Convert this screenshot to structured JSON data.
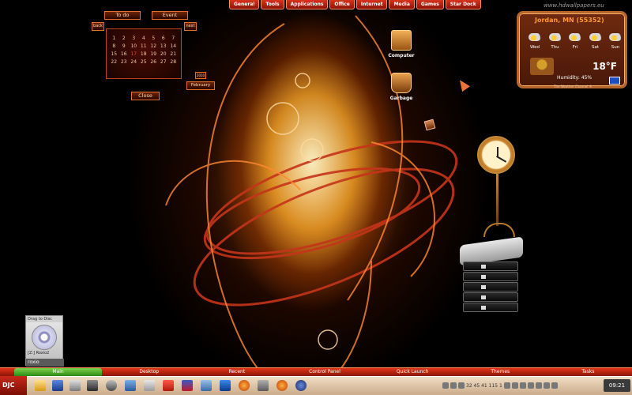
{
  "watermark": "www.hdwallpapers.eu",
  "top_menu": [
    "General",
    "Tools",
    "Applications",
    "Office",
    "Internet",
    "Media",
    "Games",
    "Star Dock"
  ],
  "calendar": {
    "todo_label": "To do",
    "event_label": "Event",
    "back_label": "back",
    "next_label": "next",
    "close_label": "Close",
    "month_label": "February",
    "year_label": "2010",
    "days": [
      "1",
      "2",
      "3",
      "4",
      "5",
      "6",
      "7",
      "8",
      "9",
      "10",
      "11",
      "12",
      "13",
      "14",
      "15",
      "16",
      "17",
      "18",
      "19",
      "20",
      "21",
      "22",
      "23",
      "24",
      "25",
      "26",
      "27",
      "28"
    ]
  },
  "desktop_icons": {
    "computer": "Computer",
    "garbage": "Garbage"
  },
  "weather": {
    "location": "Jordan, MN (55352)",
    "days": [
      "Wed",
      "Thu",
      "Fri",
      "Sat",
      "Sun"
    ],
    "temperature": "18°F",
    "humidity": "Humidity: 45%",
    "source": "The Weather Channel ®"
  },
  "drag_to_disc": {
    "title": "Drag to Disc",
    "drive": "[Z:] Roxio2",
    "brand": "roxio"
  },
  "taskbar": {
    "start_label": "DJC",
    "tabs": [
      "Main",
      "Desktop",
      "Recent",
      "Control Panel",
      "Quick Launch",
      "Themes",
      "Tasks"
    ],
    "tray_text": "32 45 41 115 1",
    "clock": "09:21"
  },
  "colors": {
    "accent": "#d8321c",
    "active_tab": "#4fae2a",
    "weather_title": "#ff9933"
  }
}
